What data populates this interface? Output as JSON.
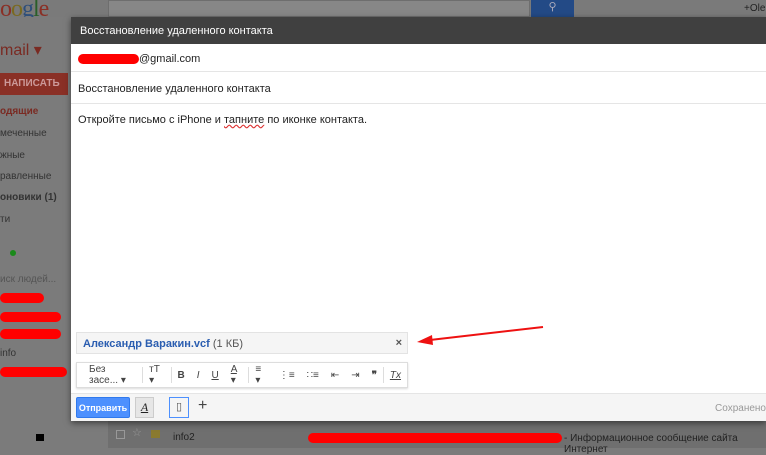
{
  "header": {
    "logo": "oogle",
    "search_icon": "search-icon",
    "user": "+Olel"
  },
  "sidebar": {
    "app": "mail",
    "compose": "НАПИСАТЬ",
    "items": [
      "одящие",
      "меченные",
      "жные",
      "равленные",
      "оновики (1)",
      "ти"
    ],
    "people_search": "иск людей...",
    "contact_info": "info"
  },
  "compose": {
    "title": "Восстановление удаленного контакта",
    "to_suffix": "@gmail.com",
    "subject": "Восстановление удаленного контакта",
    "body_before": "Откройте письмо с iPhone и ",
    "body_misspelled": "тапните",
    "body_after": " по иконке контакта.",
    "attachment": {
      "name": "Александр Варакин.vcf",
      "size": "(1 КБ)",
      "remove": "×"
    },
    "format": {
      "font": "Без засе...",
      "size": "тT",
      "bold": "B",
      "italic": "I",
      "underline": "U",
      "color": "A",
      "quote": "❞",
      "clear": "Tx"
    },
    "send": "Отправить",
    "format_toggle": "A",
    "plus": "+",
    "status": "Сохранено"
  },
  "list": {
    "sender": "info2",
    "snippet": "- Информационное сообщение сайта Интернет"
  },
  "colors": {
    "accent": "#4d90fe",
    "annotation": "#ff0000"
  }
}
